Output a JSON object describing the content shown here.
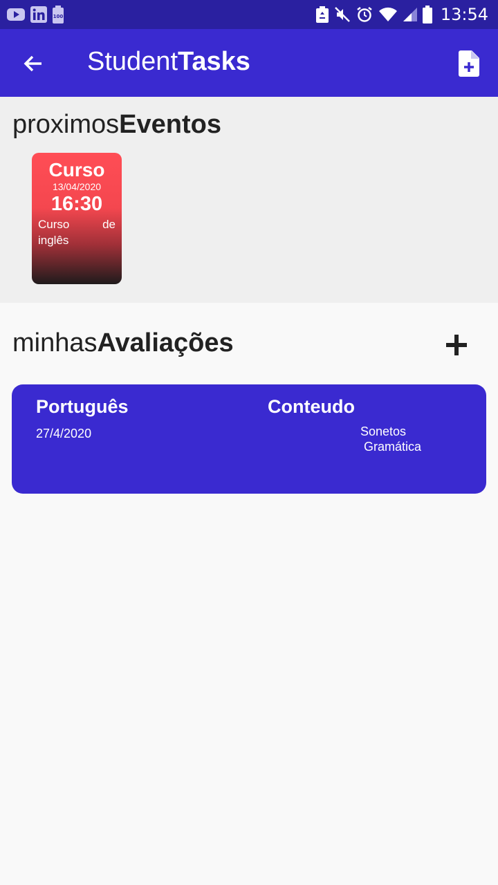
{
  "status_bar": {
    "time": "13:54",
    "left_icons": [
      "youtube-icon",
      "linkedin-icon",
      "battery-saver-icon"
    ],
    "right_icons": [
      "recycle-icon",
      "mute-icon",
      "alarm-icon",
      "wifi-icon",
      "signal-icon",
      "battery-icon"
    ]
  },
  "app_bar": {
    "title_light": "Student",
    "title_bold": "Tasks",
    "color": "#3a2ad0"
  },
  "events": {
    "title_light": "proximos",
    "title_bold": "Eventos",
    "items": [
      {
        "type": "Curso",
        "date": "13/04/2020",
        "time": "16:30",
        "desc_line1": "Curso de",
        "desc_line2": "inglês"
      }
    ]
  },
  "evaluations": {
    "title_light": "minhas",
    "title_bold": "Avaliações",
    "items": [
      {
        "subject": "Português",
        "date": "27/4/2020",
        "content_label": "Conteudo",
        "topics": [
          "Sonetos",
          "Gramática"
        ]
      }
    ]
  }
}
